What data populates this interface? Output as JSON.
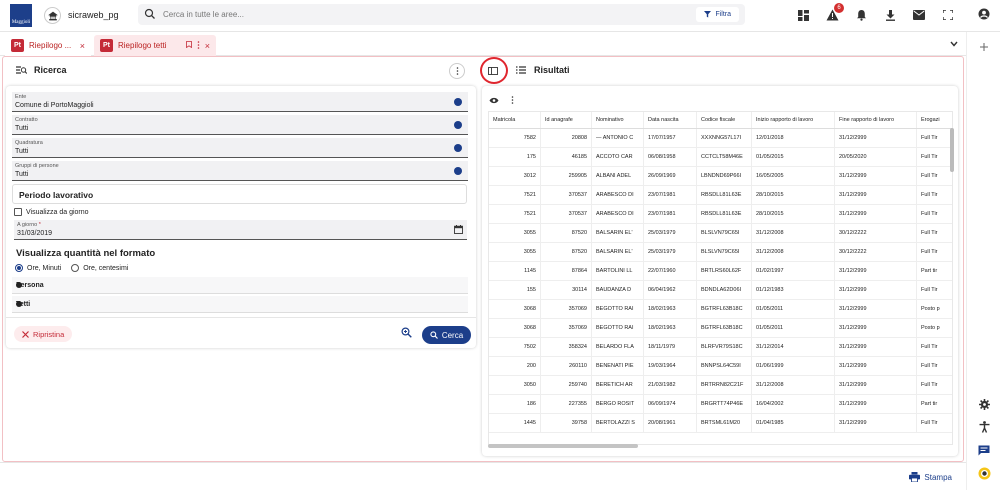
{
  "topbar": {
    "logo_text": "Maggioli",
    "instance_name": "sicraweb_pg",
    "search_placeholder": "Cerca in tutte le aree...",
    "filter_label": "Filtra",
    "notification_count": "6"
  },
  "tabs": [
    {
      "label": "Riepilogo ...",
      "active": false
    },
    {
      "label": "Riepilogo tetti",
      "active": true
    }
  ],
  "tab_tag": "Pt",
  "search_panel": {
    "title": "Ricerca",
    "fields": [
      {
        "label": "Ente",
        "value": "Comune di PortoMaggioli"
      },
      {
        "label": "Contratto",
        "value": "Tutti"
      },
      {
        "label": "Quadratura",
        "value": "Tutti"
      },
      {
        "label": "Gruppi di persone",
        "value": "Tutti"
      }
    ],
    "periodo_title": "Periodo lavorativo",
    "checkbox_label": "Visualizza da giorno",
    "date_label": "A giorno",
    "date_required_mark": "*",
    "date_value": "31/03/2019",
    "format_title": "Visualizza quantità nel formato",
    "radio_options": [
      {
        "label": "Ore, Minuti",
        "selected": true
      },
      {
        "label": "Ore, centesimi",
        "selected": false
      }
    ],
    "accordions": [
      "Persona",
      "Tetti"
    ],
    "reset_label": "Ripristina",
    "search_label": "Cerca"
  },
  "results": {
    "title": "Risultati",
    "columns": [
      "Matricola",
      "Id anagrafe",
      "Nominativo",
      "Data nascita",
      "Codice fiscale",
      "Inizio rapporto di lavoro",
      "Fine rapporto di lavoro",
      "Erogazi"
    ],
    "rows": [
      [
        "7582",
        "20808",
        "— ANTONIO C",
        "17/07/1957",
        "XXXNNG57L17I",
        "12/01/2018",
        "31/12/2999",
        "Full Tir"
      ],
      [
        "175",
        "46185",
        "ACCOTO CAR",
        "06/08/1958",
        "CCTCLT58M46E",
        "01/05/2015",
        "20/05/2020",
        "Full Tir"
      ],
      [
        "3012",
        "259905",
        "ALBANI ADEL",
        "26/09/1969",
        "LBNDND69P66I",
        "16/05/2005",
        "31/12/2999",
        "Full Tir"
      ],
      [
        "7521",
        "370537",
        "ARABESCO DI",
        "23/07/1981",
        "RBSDLL81L63E",
        "28/10/2015",
        "31/12/2999",
        "Full Tir"
      ],
      [
        "7521",
        "370537",
        "ARABESCO DI",
        "23/07/1981",
        "RBSDLL81L63E",
        "28/10/2015",
        "31/12/2999",
        "Full Tir"
      ],
      [
        "3055",
        "87520",
        "BALSARIN EL'",
        "25/03/1979",
        "BLSLVN79C65I",
        "31/12/2008",
        "30/12/2222",
        "Full Tir"
      ],
      [
        "3055",
        "87520",
        "BALSARIN EL'",
        "25/03/1979",
        "BLSLVN79C65I",
        "31/12/2008",
        "30/12/2222",
        "Full Tir"
      ],
      [
        "1145",
        "87864",
        "BARTOLINI LL",
        "22/07/1960",
        "BRTLRS60L62F",
        "01/02/1997",
        "31/12/2999",
        "Part tir"
      ],
      [
        "155",
        "30114",
        "BAUDANZA D",
        "06/04/1962",
        "BDNDLA62D06I",
        "01/12/1983",
        "31/12/2999",
        "Full Tir"
      ],
      [
        "3068",
        "357069",
        "BEGOTTO RAI",
        "18/02/1963",
        "BGTRFL63B18C",
        "01/05/2011",
        "31/12/2999",
        "Posto p"
      ],
      [
        "3068",
        "357069",
        "BEGOTTO RAI",
        "18/02/1963",
        "BGTRFL63B18C",
        "01/05/2011",
        "31/12/2999",
        "Posto p"
      ],
      [
        "7502",
        "358324",
        "BELARDO FLA",
        "18/11/1979",
        "BLRFVR79S18C",
        "31/12/2014",
        "31/12/2999",
        "Full Tir"
      ],
      [
        "200",
        "260110",
        "BENENATI PIE",
        "19/03/1964",
        "BNNPSL64C59I",
        "01/06/1999",
        "31/12/2999",
        "Full Tir"
      ],
      [
        "3050",
        "259740",
        "BERETICH AR",
        "21/03/1982",
        "BRTRRN82C21F",
        "31/12/2008",
        "31/12/2999",
        "Full Tir"
      ],
      [
        "186",
        "227355",
        "BERGO ROSIT",
        "06/09/1974",
        "BRGRTT74P46E",
        "16/04/2002",
        "31/12/2999",
        "Part tir"
      ],
      [
        "1445",
        "39758",
        "BERTOLAZZI S",
        "20/08/1961",
        "BRTSML61M20",
        "01/04/1985",
        "31/12/2999",
        "Full Tir"
      ]
    ]
  },
  "bottombar": {
    "print_label": "Stampa"
  },
  "colors": {
    "accent": "#1c3e8a",
    "tab_red": "#c42a37",
    "highlight_circle": "#e0262e"
  }
}
